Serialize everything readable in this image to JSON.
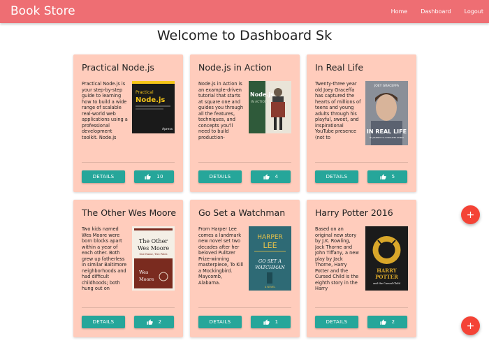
{
  "app": {
    "brand": "Book Store"
  },
  "nav": {
    "home": "Home",
    "dashboard": "Dashboard",
    "logout": "Logout"
  },
  "page": {
    "title": "Welcome to Dashboard Sk"
  },
  "books": [
    {
      "title": "Practical Node.js",
      "description": "Practical Node.js is your step-by-step guide to learning how to build a wide range of scalable real-world web applications using a professional development toolkit. Node.js",
      "details_label": "DETAILS",
      "likes": "10",
      "cover": {
        "bg": "#1a1a1a",
        "accent": "#f5c518",
        "text": "Practical Node.js",
        "publisher": "Apress"
      }
    },
    {
      "title": "Node.js in Action",
      "description": "Node.js in Action is an example-driven tutorial that starts at square one and guides you through all the features, techniques, and concepts you'll need to build production-",
      "details_label": "DETAILS",
      "likes": "4",
      "cover": {
        "bg": "#2f5a3a",
        "accent": "#c8d4c0",
        "text": "Node.js IN ACTION"
      }
    },
    {
      "title": "In Real Life",
      "description": "Twenty-three year old Joey Graceffa has captured the hearts of millions of teens and young adults through his playful, sweet, and inspirational YouTube presence (not to",
      "details_label": "DETAILS",
      "likes": "5",
      "cover": {
        "bg": "#8a8f98",
        "accent": "#ffffff",
        "author": "JOEY GRACEFFA",
        "text": "IN REAL LIFE",
        "subtitle": "MY JOURNEY TO A PIXELATED WORLD"
      }
    },
    {
      "title": "The Other Wes Moore",
      "description": "Two kids named Wes Moore were born blocks apart within a year of each other. Both grew up fatherless in similar Baltimore neighborhoods and had difficult childhoods; both hung out on",
      "details_label": "DETAILS",
      "likes": "2",
      "cover": {
        "bg": "#f4efe6",
        "accent": "#7a2b1f",
        "text": "The Other Wes Moore",
        "tagline": "One Name, Two Fates",
        "author": "Wes Moore"
      }
    },
    {
      "title": "Go Set a Watchman",
      "description": "From Harper Lee comes a landmark new novel set two decades after her beloved Pulitzer Prize-winning masterpiece, To Kill a Mockingbird. Maycomb, Alabama.",
      "details_label": "DETAILS",
      "likes": "1",
      "cover": {
        "bg": "#2e6a75",
        "accent": "#e9c34a",
        "author": "HARPER LEE",
        "text": "GO SET A WATCHMAN",
        "note": "A NOVEL"
      }
    },
    {
      "title": "Harry Potter 2016",
      "description": "Based on an original new story by J.K. Rowling, Jack Thorne and John Tiffany, a new play by Jack Thorne, Harry Potter and the Cursed Child is the eighth story in the Harry",
      "details_label": "DETAILS",
      "likes": "2",
      "cover": {
        "bg": "#1b1b1b",
        "accent": "#d9a72a",
        "text": "HARRY POTTER",
        "subtitle": "and the Cursed Child"
      }
    }
  ],
  "fab": {
    "label": "+"
  },
  "colors": {
    "navbar": "#ee6e73",
    "card": "#ffccbc",
    "button": "#26a69a",
    "fab": "#f44336"
  }
}
